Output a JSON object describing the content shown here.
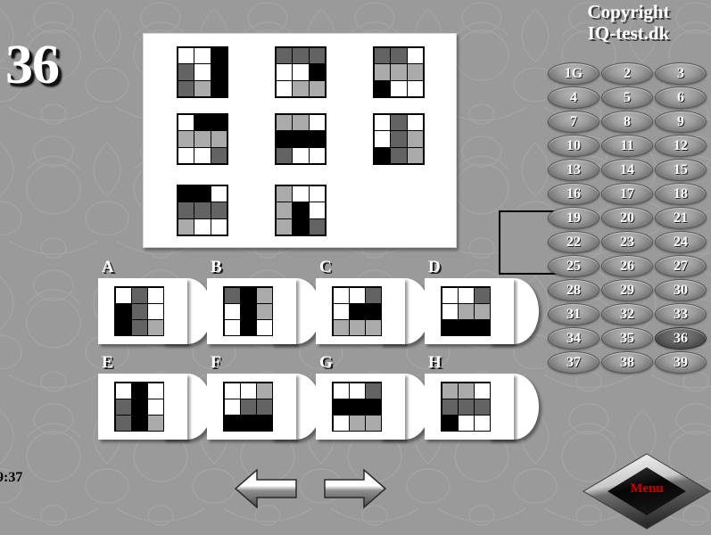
{
  "app": {
    "question_number": "36",
    "timer": "9:37",
    "copyright_line1": "Copyright",
    "copyright_line2": "IQ-test.dk",
    "background_color": "#9a9a9a",
    "menu_label": "Menu",
    "menu_label_color": "#cc0000"
  },
  "palette": {
    "white": "#ffffff",
    "light_gray": "#aaaaaa",
    "dark_gray": "#636363",
    "black": "#000000"
  },
  "matrix": {
    "description": "3x3 matrix of 3x3 shaded grids, bottom-right cell missing",
    "cells": [
      {
        "id": "m1",
        "rows": [
          [
            "w",
            "w",
            "k"
          ],
          [
            "d",
            "w",
            "k"
          ],
          [
            "d",
            "l",
            "k"
          ]
        ]
      },
      {
        "id": "m2",
        "rows": [
          [
            "d",
            "d",
            "d"
          ],
          [
            "w",
            "w",
            "k"
          ],
          [
            "w",
            "l",
            "l"
          ]
        ]
      },
      {
        "id": "m3",
        "rows": [
          [
            "d",
            "d",
            "w"
          ],
          [
            "l",
            "l",
            "l"
          ],
          [
            "k",
            "w",
            "w"
          ]
        ]
      },
      {
        "id": "m4",
        "rows": [
          [
            "w",
            "k",
            "k"
          ],
          [
            "l",
            "l",
            "l"
          ],
          [
            "w",
            "w",
            "d"
          ]
        ]
      },
      {
        "id": "m5",
        "rows": [
          [
            "l",
            "l",
            "w"
          ],
          [
            "k",
            "k",
            "k"
          ],
          [
            "d",
            "w",
            "w"
          ]
        ]
      },
      {
        "id": "m6",
        "rows": [
          [
            "w",
            "d",
            "w"
          ],
          [
            "w",
            "d",
            "l"
          ],
          [
            "k",
            "d",
            "l"
          ]
        ]
      },
      {
        "id": "m7",
        "rows": [
          [
            "k",
            "k",
            "w"
          ],
          [
            "d",
            "d",
            "d"
          ],
          [
            "l",
            "w",
            "w"
          ]
        ]
      },
      {
        "id": "m8",
        "rows": [
          [
            "l",
            "w",
            "w"
          ],
          [
            "l",
            "k",
            "w"
          ],
          [
            "l",
            "k",
            "d"
          ]
        ]
      },
      {
        "id": "m9",
        "rows": null
      }
    ]
  },
  "options": [
    {
      "letter": "A",
      "rows": [
        [
          "w",
          "d",
          "w"
        ],
        [
          "k",
          "d",
          "w"
        ],
        [
          "k",
          "d",
          "l"
        ]
      ]
    },
    {
      "letter": "B",
      "rows": [
        [
          "d",
          "k",
          "l"
        ],
        [
          "w",
          "k",
          "l"
        ],
        [
          "w",
          "k",
          "w"
        ]
      ]
    },
    {
      "letter": "C",
      "rows": [
        [
          "w",
          "w",
          "d"
        ],
        [
          "w",
          "k",
          "k"
        ],
        [
          "l",
          "l",
          "l"
        ]
      ]
    },
    {
      "letter": "D",
      "rows": [
        [
          "w",
          "w",
          "d"
        ],
        [
          "w",
          "l",
          "l"
        ],
        [
          "k",
          "k",
          "k"
        ]
      ]
    },
    {
      "letter": "E",
      "rows": [
        [
          "w",
          "k",
          "w"
        ],
        [
          "d",
          "k",
          "w"
        ],
        [
          "d",
          "k",
          "l"
        ]
      ]
    },
    {
      "letter": "F",
      "rows": [
        [
          "w",
          "w",
          "l"
        ],
        [
          "w",
          "d",
          "d"
        ],
        [
          "k",
          "k",
          "k"
        ]
      ]
    },
    {
      "letter": "G",
      "rows": [
        [
          "w",
          "w",
          "d"
        ],
        [
          "k",
          "k",
          "k"
        ],
        [
          "w",
          "l",
          "l"
        ]
      ]
    },
    {
      "letter": "H",
      "rows": [
        [
          "l",
          "l",
          "w"
        ],
        [
          "d",
          "d",
          "d"
        ],
        [
          "k",
          "w",
          "w"
        ]
      ]
    }
  ],
  "number_pad": {
    "selected": "36",
    "buttons": [
      "1G",
      "2",
      "3",
      "4",
      "5",
      "6",
      "7",
      "8",
      "9",
      "10",
      "11",
      "12",
      "13",
      "14",
      "15",
      "16",
      "17",
      "18",
      "19",
      "20",
      "21",
      "22",
      "23",
      "24",
      "25",
      "26",
      "27",
      "28",
      "29",
      "30",
      "31",
      "32",
      "33",
      "34",
      "35",
      "36",
      "37",
      "38",
      "39"
    ]
  },
  "navigation": {
    "previous_label": "previous-question",
    "next_label": "next-question"
  }
}
